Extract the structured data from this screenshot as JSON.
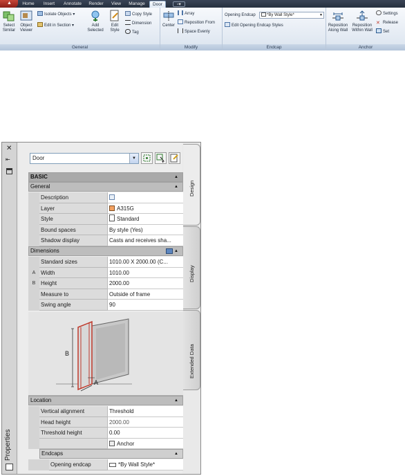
{
  "ribbon": {
    "tabs": [
      "Home",
      "Insert",
      "Annotate",
      "Render",
      "View",
      "Manage",
      "Door"
    ],
    "active_tab": "Door",
    "panels": {
      "general": {
        "title": "General",
        "select_similar": [
          "Select",
          "Similar"
        ],
        "object_viewer": [
          "Object",
          "Viewer"
        ],
        "isolate_objects": "Isolate Objects",
        "edit_in_section": "Edit in Section"
      },
      "style": {
        "add_selected": [
          "Add",
          "Selected"
        ],
        "edit_style": [
          "Edit",
          "Style"
        ],
        "copy_style": "Copy Style",
        "dimension": "Dimension",
        "tag": "Tag"
      },
      "modify": {
        "title": "Modify",
        "center": "Center",
        "array": "Array",
        "reposition_from": "Reposition From",
        "space_evenly": "Space Evenly"
      },
      "endcap": {
        "title": "Endcap",
        "opening_endcap_label": "Opening Endcap",
        "opening_endcap_value": "*By Wall Style*",
        "edit_opening_endcap_styles": "Edit Opening Endcap Styles"
      },
      "anchor": {
        "title": "Anchor",
        "reposition_along_wall": [
          "Reposition",
          "Along Wall"
        ],
        "reposition_within_wall": [
          "Reposition",
          "Within Wall"
        ],
        "settings": "Settings",
        "release": "Release",
        "set": "Set"
      }
    }
  },
  "palette": {
    "title": "Properties",
    "object_type": "Door",
    "side_tabs": [
      "Design",
      "Display",
      "Extended Data"
    ],
    "categories": {
      "basic": "BASIC",
      "general": "General",
      "dimensions": "Dimensions",
      "location": "Location",
      "endcaps": "Endcaps"
    },
    "general_rows": [
      {
        "name": "Description",
        "value": ""
      },
      {
        "name": "Layer",
        "value": "A315G"
      },
      {
        "name": "Style",
        "value": "Standard"
      },
      {
        "name": "Bound spaces",
        "value": "By style (Yes)"
      },
      {
        "name": "Shadow display",
        "value": "Casts and receives sha..."
      }
    ],
    "dimension_rows": [
      {
        "marker": "",
        "name": "Standard sizes",
        "value": "1010.00 X 2000.00 (C..."
      },
      {
        "marker": "A",
        "name": "Width",
        "value": "1010.00"
      },
      {
        "marker": "B",
        "name": "Height",
        "value": "2000.00"
      },
      {
        "marker": "",
        "name": "Measure to",
        "value": "Outside of frame"
      },
      {
        "marker": "",
        "name": "Swing angle",
        "value": "90"
      }
    ],
    "illustration_labels": {
      "a": "A",
      "b": "B"
    },
    "location_rows": [
      {
        "name": "Vertical alignment",
        "value": "Threshold"
      },
      {
        "name": "Head height",
        "value": "2000.00"
      },
      {
        "name": "Threshold height",
        "value": "0.00"
      },
      {
        "name": "",
        "value": "Anchor"
      }
    ],
    "endcap_rows": [
      {
        "name": "Opening endcap",
        "value": "*By Wall Style*"
      }
    ]
  }
}
